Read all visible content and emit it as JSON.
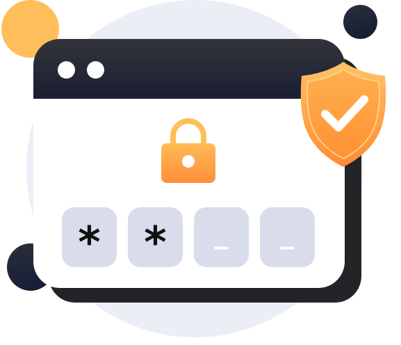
{
  "colors": {
    "accent_orange": "#ff9a3d",
    "accent_orange_light": "#ffbe5a",
    "dark_navy": "#1a1e32",
    "pin_box": "#d9dcea",
    "background_circle": "#eceef6"
  },
  "window": {
    "title_dots": [
      "window-dot",
      "window-dot"
    ]
  },
  "lock": {
    "icon": "padlock-icon"
  },
  "pin": {
    "fields": [
      {
        "char": "*",
        "state": "filled"
      },
      {
        "char": "*",
        "state": "filled"
      },
      {
        "char": "_",
        "state": "empty"
      },
      {
        "char": "_",
        "state": "empty"
      }
    ]
  },
  "shield": {
    "icon": "shield-check-icon"
  }
}
